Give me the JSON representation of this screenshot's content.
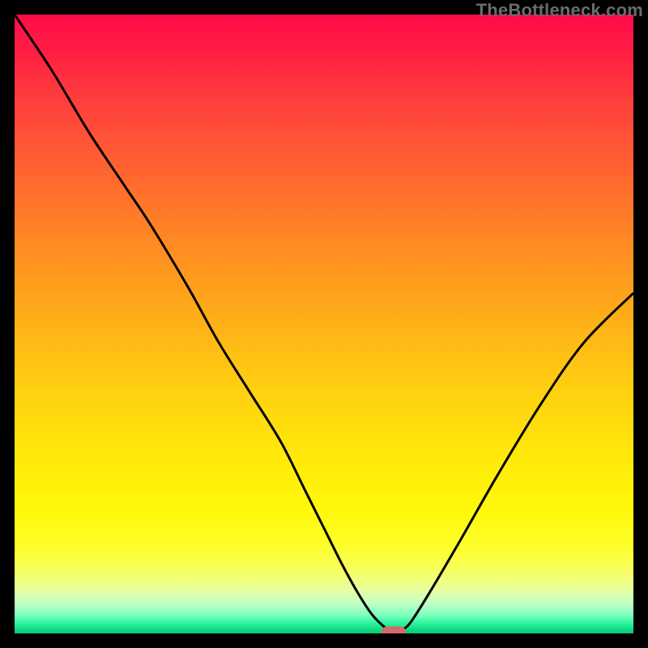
{
  "watermark": "TheBottleneck.com",
  "colors": {
    "frame": "#000000",
    "curve_stroke": "#000000",
    "marker_fill": "#d46a6a"
  },
  "chart_data": {
    "type": "line",
    "title": "",
    "xlabel": "",
    "ylabel": "",
    "xlim": [
      0,
      100
    ],
    "ylim": [
      0,
      100
    ],
    "grid": false,
    "legend": false,
    "series": [
      {
        "name": "bottleneck-curve",
        "x": [
          0,
          6,
          12,
          18,
          22,
          28,
          33,
          38,
          43,
          47,
          50,
          53,
          55.5,
          57.8,
          59.8,
          60.8,
          61.6,
          62.5,
          64,
          67,
          72,
          78,
          85,
          92,
          100
        ],
        "values": [
          100,
          91,
          81,
          72,
          66,
          56,
          47,
          39,
          31,
          23,
          17,
          11,
          6.5,
          3.0,
          1.0,
          0.3,
          0.2,
          0.5,
          1.8,
          6.5,
          15,
          25.5,
          37,
          47,
          55
        ]
      }
    ],
    "marker": {
      "x": 61.2,
      "y": 0.3
    }
  }
}
